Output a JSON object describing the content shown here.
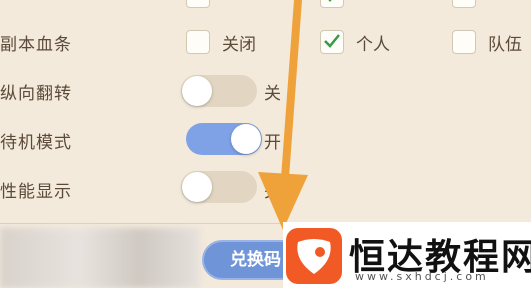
{
  "settings": {
    "rows": [
      {
        "label": "副本血条"
      },
      {
        "label": "纵向翻转"
      },
      {
        "label": "待机模式"
      },
      {
        "label": "性能显示"
      }
    ],
    "health_bar_options": [
      {
        "label": "关闭",
        "checked": false
      },
      {
        "label": "个人",
        "checked": true
      },
      {
        "label": "队伍",
        "checked": false
      }
    ],
    "toggles": [
      {
        "state_label": "关",
        "on": false
      },
      {
        "state_label": "开",
        "on": true
      },
      {
        "state_label": "关",
        "on": false
      }
    ]
  },
  "redeem": {
    "label": "兑换码"
  },
  "watermark": {
    "title": "恒达教程网",
    "url": "www.sxhdcj.com"
  },
  "colors": {
    "background": "#f3eadc",
    "accent": "#7fa2e6",
    "arrow": "#f0a23a",
    "check": "#3a9a4a"
  }
}
